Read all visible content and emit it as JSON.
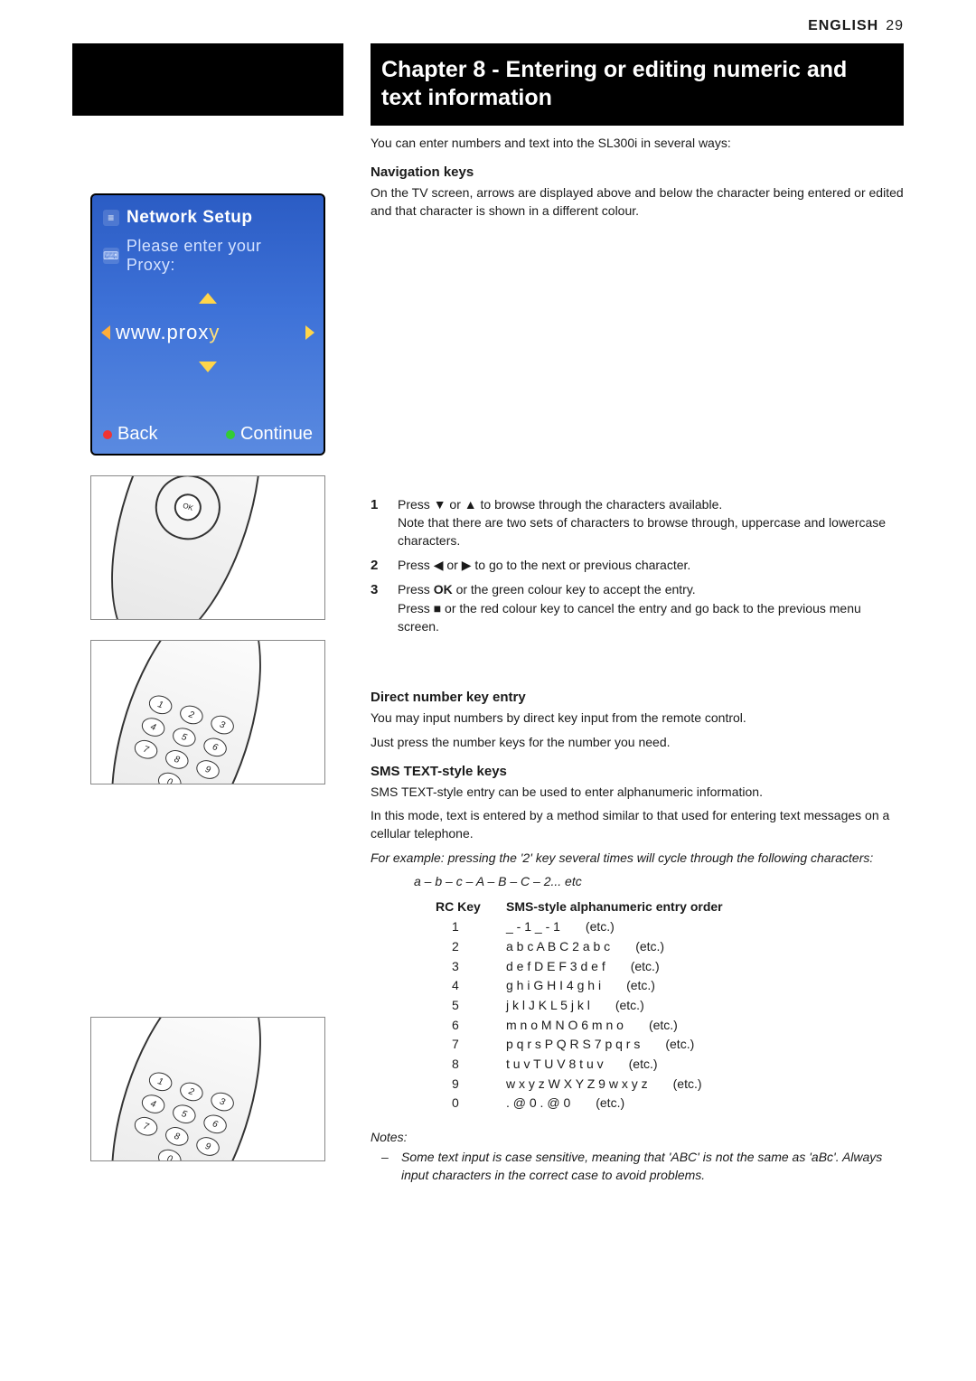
{
  "header": {
    "language": "ENGLISH",
    "page_number": "29"
  },
  "chapter": {
    "title": "Chapter 8 - Entering or editing numeric and text information"
  },
  "intro": "You can enter numbers and text into the SL300i in several ways:",
  "tv": {
    "title": "Network Setup",
    "prompt": "Please enter your Proxy:",
    "entry_prefix": "www.prox",
    "entry_cursor": "y",
    "back": "Back",
    "continue": "Continue"
  },
  "nav": {
    "heading": "Navigation keys",
    "body": "On the TV screen, arrows are displayed above and below the character being entered or edited and that character is shown in a different colour."
  },
  "steps": [
    {
      "n": "1",
      "lead_pre": "Press ",
      "lead_sym": "▼",
      "lead_mid": " or ",
      "lead_sym2": "▲",
      "lead_post": " to browse through the characters available.",
      "note": "Note that there are two sets of characters to browse through, uppercase and lowercase characters."
    },
    {
      "n": "2",
      "lead_pre": "Press ",
      "lead_sym": "◀",
      "lead_mid": " or ",
      "lead_sym2": "▶",
      "lead_post": " to go to the next or previous character.",
      "note": ""
    },
    {
      "n": "3",
      "lead_pre": "Press ",
      "lead_bold": "OK",
      "lead_post": " or the green colour key to accept the entry.",
      "note_pre": "Press ",
      "note_sym": "■",
      "note_post": " or the red colour key to cancel the entry and go back to the previous menu screen."
    }
  ],
  "direct": {
    "heading": "Direct number key entry",
    "l1": "You may input numbers by direct key input from the remote control.",
    "l2": "Just press the number keys for the number you need."
  },
  "sms": {
    "heading": "SMS TEXT-style keys",
    "l1": "SMS TEXT-style entry can be used to enter alphanumeric information.",
    "l2": "In this mode, text is entered by a method similar to that used for entering text messages on a cellular telephone.",
    "example_lead": "For example: pressing the '2' key several times will cycle through the following characters:",
    "example_seq": "a – b – c – A – B – C – 2... etc",
    "col_key": "RC Key",
    "col_order": "SMS-style alphanumeric entry order",
    "etc": "(etc.)",
    "rows": [
      {
        "k": "1",
        "v": "_ - 1 _ - 1"
      },
      {
        "k": "2",
        "v": "a b c A B C 2 a b c"
      },
      {
        "k": "3",
        "v": "d e f D E F 3 d e f"
      },
      {
        "k": "4",
        "v": "g h i G H I 4 g h i"
      },
      {
        "k": "5",
        "v": "j k l J K L 5 j k l"
      },
      {
        "k": "6",
        "v": "m n o M N O 6 m n o"
      },
      {
        "k": "7",
        "v": "p q r s P Q R S 7 p q r s"
      },
      {
        "k": "8",
        "v": "t u v T U V 8 t u v"
      },
      {
        "k": "9",
        "v": "w x y z W X Y Z 9 w x y z"
      },
      {
        "k": "0",
        "v": ". @ 0 . @ 0"
      }
    ]
  },
  "notes": {
    "heading": "Notes:",
    "items": [
      "Some text input is case sensitive, meaning that 'ABC' is not the same as 'aBc'. Always input characters in the correct case to avoid problems."
    ]
  }
}
